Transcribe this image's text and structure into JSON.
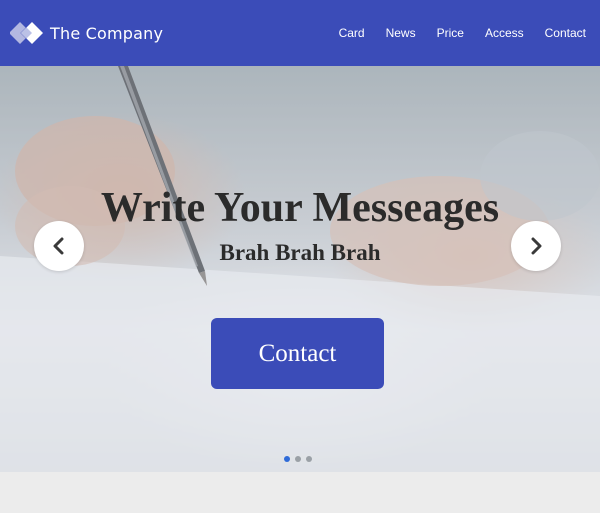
{
  "header": {
    "brand_name": "The Company",
    "nav": [
      "Card",
      "News",
      "Price",
      "Access",
      "Contact"
    ],
    "background_color": "#3b4cb8"
  },
  "hero": {
    "title": "Write Your Messeages",
    "subtitle": "Brah Brah Brah",
    "cta_label": "Contact",
    "cta_color": "#3b4cb8",
    "prev_icon": "chevron-left-icon",
    "next_icon": "chevron-right-icon",
    "slide_count": 3,
    "active_slide": 1,
    "active_dot_color": "#2f6bd8"
  }
}
